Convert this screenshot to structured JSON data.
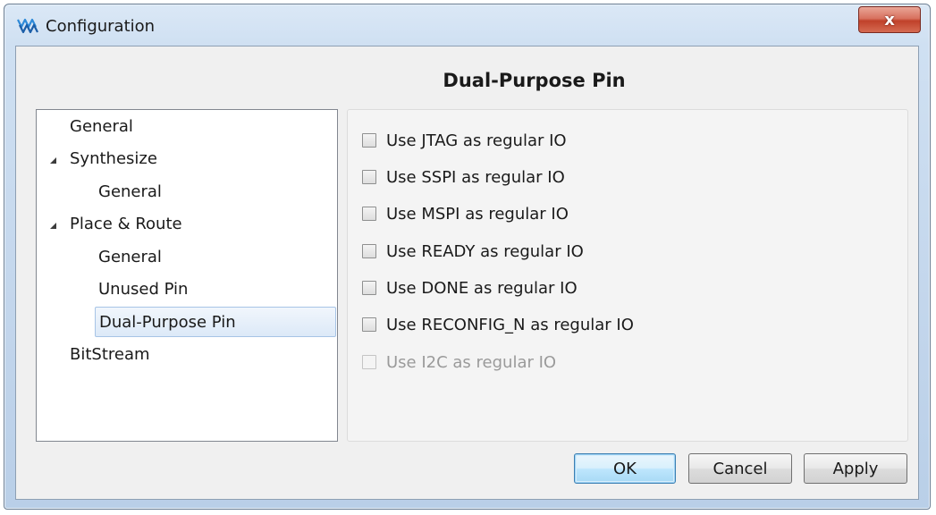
{
  "window": {
    "title": "Configuration",
    "close_label": "x"
  },
  "page": {
    "heading": "Dual-Purpose Pin"
  },
  "tree": {
    "items": [
      {
        "label": "General"
      },
      {
        "label": "Synthesize"
      },
      {
        "label": "General"
      },
      {
        "label": "Place & Route"
      },
      {
        "label": "General"
      },
      {
        "label": "Unused Pin"
      },
      {
        "label": "Dual-Purpose Pin",
        "selected": true
      },
      {
        "label": "BitStream"
      }
    ]
  },
  "options": [
    {
      "label": "Use JTAG as regular IO",
      "checked": false,
      "enabled": true
    },
    {
      "label": "Use SSPI as regular IO",
      "checked": false,
      "enabled": true
    },
    {
      "label": "Use MSPI as regular IO",
      "checked": false,
      "enabled": true
    },
    {
      "label": "Use READY as regular IO",
      "checked": false,
      "enabled": true
    },
    {
      "label": "Use DONE as regular IO",
      "checked": false,
      "enabled": true
    },
    {
      "label": "Use RECONFIG_N as regular IO",
      "checked": false,
      "enabled": true
    },
    {
      "label": "Use I2C as regular IO",
      "checked": false,
      "enabled": false
    }
  ],
  "buttons": {
    "ok": "OK",
    "cancel": "Cancel",
    "apply": "Apply"
  },
  "colors": {
    "selection": "#dce9f8",
    "close_button": "#c0412a",
    "default_button": "#bee6fd"
  }
}
